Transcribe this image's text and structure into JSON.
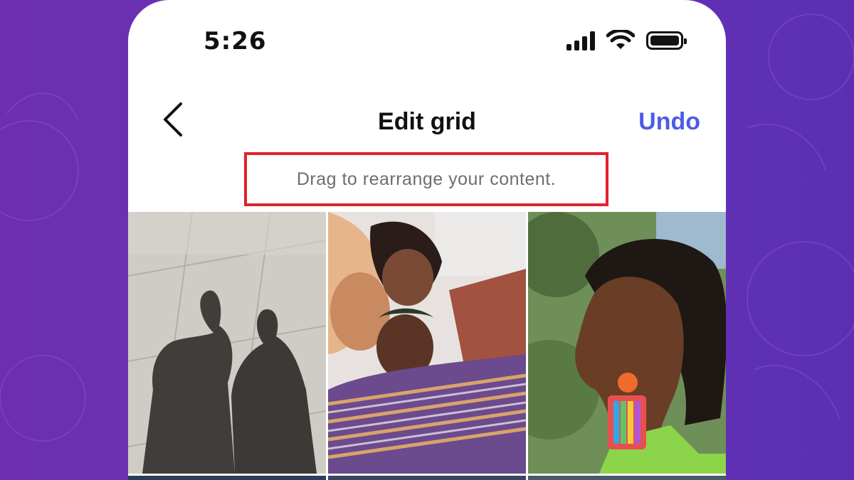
{
  "status_bar": {
    "time": "5:26",
    "icons": [
      "cellular-signal-icon",
      "wifi-icon",
      "battery-icon"
    ]
  },
  "nav": {
    "back_icon": "chevron-left-icon",
    "title": "Edit grid",
    "undo_label": "Undo"
  },
  "hint": {
    "text": "Drag to rearrange your content."
  },
  "grid": {
    "tiles": [
      {
        "name": "photo-shadows-sidewalk"
      },
      {
        "name": "photo-friends-looking-down"
      },
      {
        "name": "photo-woman-rainbow-earring"
      }
    ]
  },
  "colors": {
    "background": "#6a33b6",
    "accent": "#4c5ce6",
    "highlight_border": "#e3222a",
    "hint_text": "#6e6e6e"
  }
}
